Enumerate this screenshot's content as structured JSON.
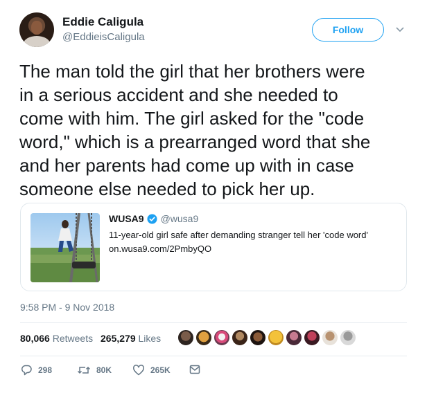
{
  "author": {
    "name": "Eddie Caligula",
    "handle": "@EddieisCaligula"
  },
  "follow_label": "Follow",
  "tweet_lines": [
    "The man told the girl that her brothers were",
    "in a serious accident and she needed to",
    "come with him. The girl asked for the \"code",
    "word,\" which is a prearranged word that she",
    "and her parents had come up with in case",
    "someone else needed to pick her up."
  ],
  "card": {
    "source_name": "WUSA9",
    "source_handle": "@wusa9",
    "title": "11-year-old girl safe after demanding stranger tell her 'code word'",
    "url": "on.wusa9.com/2PmbyQO"
  },
  "timestamp": "9:58 PM - 9 Nov 2018",
  "stats": {
    "retweets_count": "80,066",
    "retweets_label": "Retweets",
    "likes_count": "265,279",
    "likes_label": "Likes"
  },
  "actions": {
    "reply_count": "298",
    "retweet_count": "80K",
    "like_count": "265K"
  },
  "colors": {
    "accent": "#1da1f2",
    "secondary_text": "#657786",
    "border": "#e1e8ed"
  },
  "icons": {
    "caret": "chevron-down-icon",
    "verified": "verified-badge-icon",
    "reply": "reply-icon",
    "retweet": "retweet-icon",
    "like": "heart-icon",
    "dm": "envelope-icon"
  }
}
